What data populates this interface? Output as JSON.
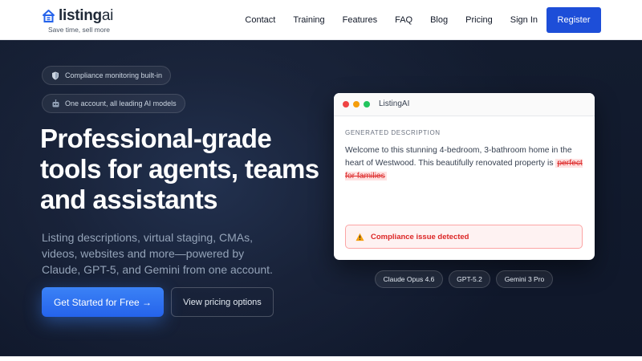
{
  "brand": {
    "name_main": "listing",
    "name_suffix": "ai",
    "tagline": "Save time, sell more"
  },
  "nav": {
    "links": [
      "Contact",
      "Training",
      "Features",
      "FAQ",
      "Blog",
      "Pricing",
      "Sign In"
    ],
    "register_label": "Register"
  },
  "hero": {
    "pills": [
      {
        "icon": "shield-icon",
        "text": "Compliance monitoring built-in"
      },
      {
        "icon": "robot-icon",
        "text": "One account, all leading AI models"
      }
    ],
    "headline": "Professional-grade tools for agents, teams and assistants",
    "subtext": "Listing descriptions, virtual staging, CMAs, videos, websites and more—powered by Claude, GPT-5, and Gemini from one account.",
    "cta_primary": "Get Started for Free →",
    "cta_secondary": "View pricing options"
  },
  "preview": {
    "window_title": "ListingAI",
    "section_label": "GENERATED DESCRIPTION",
    "body_text": "Welcome to this stunning 4-bedroom, 3-bathroom home in the heart of Westwood. This beautifully renovated property is",
    "flagged_text": "perfect for families",
    "alert_text": "Compliance issue detected"
  },
  "models": [
    "Claude Opus 4.6",
    "GPT-5.2",
    "Gemini 3 Pro"
  ],
  "colors": {
    "brand_blue": "#1d4ed8",
    "cta_blue": "#3b82f6",
    "hero_bg": "#0f172a",
    "alert_red": "#dc2626"
  }
}
